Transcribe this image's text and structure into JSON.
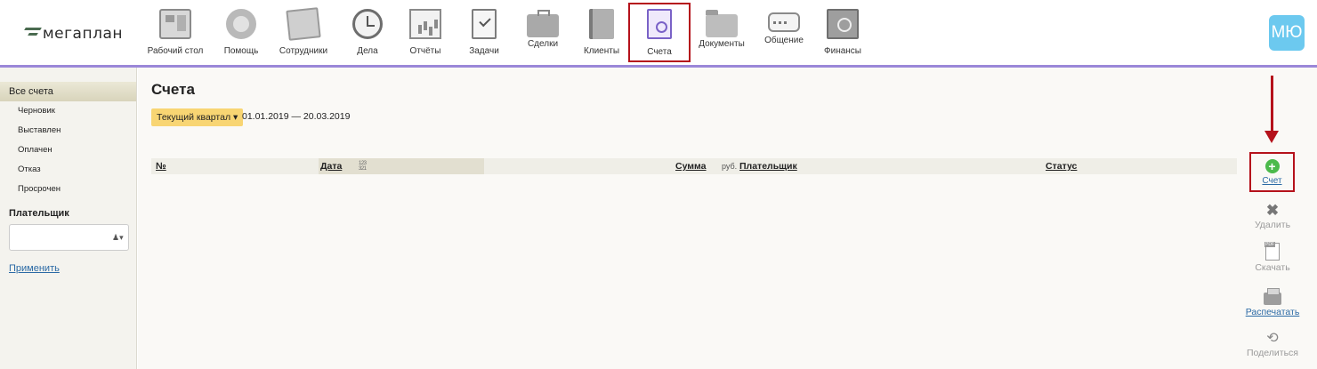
{
  "logo": {
    "text": "мегаплан"
  },
  "nav": [
    {
      "label": "Рабочий стол",
      "icon": "desktop-icon"
    },
    {
      "label": "Помощь",
      "icon": "lifebuoy-icon"
    },
    {
      "label": "Сотрудники",
      "icon": "employees-icon"
    },
    {
      "label": "Дела",
      "icon": "clock-icon"
    },
    {
      "label": "Отчёты",
      "icon": "chart-icon"
    },
    {
      "label": "Задачи",
      "icon": "task-checklist-icon"
    },
    {
      "label": "Сделки",
      "icon": "briefcase-icon"
    },
    {
      "label": "Клиенты",
      "icon": "contacts-book-icon"
    },
    {
      "label": "Счета",
      "icon": "invoice-icon",
      "active": true
    },
    {
      "label": "Документы",
      "icon": "folder-icon"
    },
    {
      "label": "Общение",
      "icon": "chat-icon"
    },
    {
      "label": "Финансы",
      "icon": "safe-icon"
    }
  ],
  "user": {
    "initials": "МЮ",
    "color": "#6cc9ef"
  },
  "sidebar": {
    "first_item": "Все счета",
    "items": [
      "Черновик",
      "Выставлен",
      "Оплачен",
      "Отказ",
      "Просрочен"
    ],
    "payer_heading": "Плательщик",
    "payer_value": "",
    "apply_link": "Применить"
  },
  "main": {
    "title": "Счета",
    "period_label": "Текущий квартал",
    "period_range": "01.01.2019 — 20.03.2019",
    "columns": {
      "number": "№",
      "date": "Дата",
      "amount": "Сумма",
      "amount_unit": "руб.",
      "payer": "Плательщик",
      "status": "Статус"
    }
  },
  "actions": {
    "new": "Счет",
    "delete": "Удалить",
    "download": "Скачать",
    "print": "Распечатать",
    "share": "Поделиться"
  },
  "colors": {
    "accent_line": "#9b87d8",
    "highlight_border": "#b5121b",
    "period_button": "#f8d573",
    "add_button": "#4cba4c",
    "link": "#2b6aa5"
  }
}
